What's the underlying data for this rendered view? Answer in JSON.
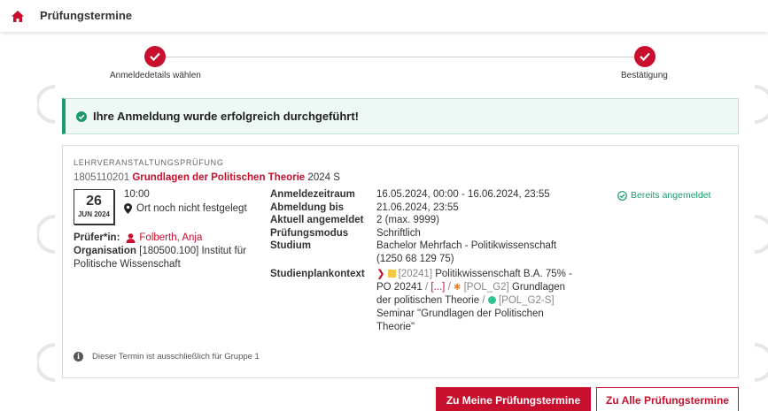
{
  "header": {
    "title": "Prüfungstermine"
  },
  "stepper": {
    "steps": [
      {
        "label": "Anmeldedetails wählen"
      },
      {
        "label": "Bestätigung"
      }
    ]
  },
  "alert": {
    "message": "Ihre Anmeldung wurde erfolgreich durchgeführt!"
  },
  "exam": {
    "type": "LEHRVERANSTALTUNGSPRÜFUNG",
    "number": "1805110201",
    "title": "Grundlagen der Politischen Theorie",
    "semester": "2024 S",
    "date": {
      "day": "26",
      "month": "JUN 2024"
    },
    "time": "10:00",
    "location": "Ort noch nicht festgelegt",
    "examiner_label": "Prüfer*in:",
    "examiner": "Folberth, Anja",
    "organisation_label": "Organisation",
    "organisation": "[180500.100] Institut für Politische Wissenschaft",
    "status": "Bereits angemeldet",
    "details": {
      "anmeldezeitraum_label": "Anmeldezeitraum",
      "anmeldezeitraum": "16.05.2024, 00:00 - 16.06.2024, 23:55",
      "abmeldung_label": "Abmeldung bis",
      "abmeldung": "21.06.2024, 23:55",
      "angemeldet_label": "Aktuell angemeldet",
      "angemeldet": "2 (max. 9999)",
      "modus_label": "Prüfungsmodus",
      "modus": "Schriftlich",
      "studium_label": "Studium",
      "studium": "Bachelor Mehrfach - Politikwissenschaft (1250 68 129 75)",
      "kontext_label": "Studienplankontext"
    },
    "context": {
      "code1": "[20241]",
      "text1": "Politikwissenschaft B.A. 75% - PO 20241",
      "sep": "/",
      "ellipsis": "[...]",
      "code2": "[POL_G2]",
      "text2": "Grundlagen der politischen Theorie",
      "code3": "[POL_G2-S]",
      "text3": "Seminar \"Grundlagen der Politischen Theorie\""
    },
    "note": "Dieser Termin ist ausschließlich für Gruppe 1"
  },
  "buttons": {
    "my_exams": "Zu Meine Prüfungstermine",
    "all_exams": "Zu Alle Prüfungstermine"
  },
  "colors": {
    "accent": "#c8102e",
    "success": "#1e9a6b",
    "success_bg": "#eef8f4"
  }
}
